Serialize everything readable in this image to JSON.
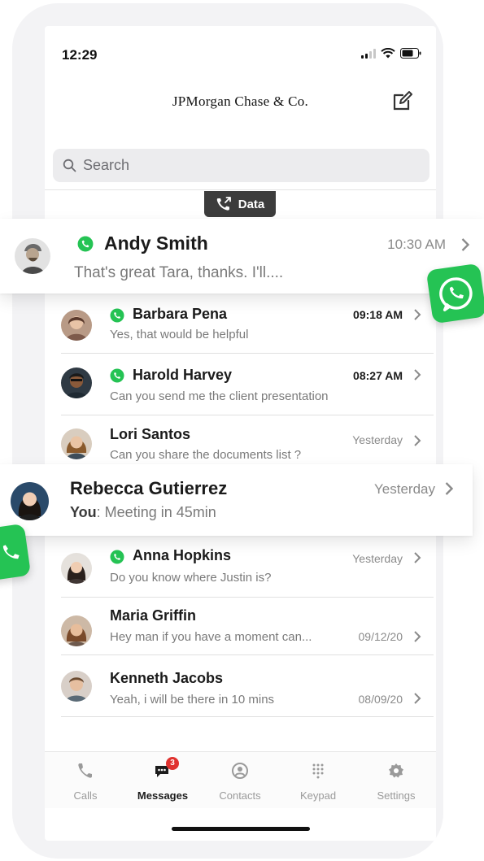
{
  "status_bar": {
    "time": "12:29"
  },
  "header": {
    "brand": "JPMorgan Chase & Co."
  },
  "search": {
    "placeholder": "Search"
  },
  "data_pill": {
    "label": "Data"
  },
  "floating_cards": [
    {
      "name": "Andy Smith",
      "message": "That's great Tara, thanks. I'll....",
      "time": "10:30 AM",
      "whatsapp": true
    },
    {
      "name": "Rebecca Gutierrez",
      "sender": "You",
      "message": ":  Meeting in 45min",
      "time": "Yesterday",
      "whatsapp": false
    }
  ],
  "conversations": [
    {
      "name": "Barbara Pena",
      "message": "Yes, that would be helpful",
      "time": "09:18 AM",
      "whatsapp": true
    },
    {
      "name": "Harold Harvey",
      "message": "Can you send me the client presentation",
      "time": "08:27 AM",
      "whatsapp": true
    },
    {
      "name": "Lori Santos",
      "message": "Can you share the documents list ?",
      "time": "Yesterday",
      "whatsapp": false
    },
    {
      "name": "Anna Hopkins",
      "message": "Do you know where Justin is?",
      "time": "Yesterday",
      "whatsapp": true
    },
    {
      "name": "Maria Griffin",
      "message": "Hey man if you have a moment can...",
      "time": "09/12/20",
      "whatsapp": false
    },
    {
      "name": "Kenneth Jacobs",
      "message": "Yeah, i will be there in 10 mins",
      "time": "08/09/20",
      "whatsapp": false
    }
  ],
  "tabbar": {
    "tabs": [
      {
        "label": "Calls",
        "icon": "phone-icon"
      },
      {
        "label": "Messages",
        "icon": "chat-icon",
        "badge": "3",
        "active": true
      },
      {
        "label": "Contacts",
        "icon": "person-icon"
      },
      {
        "label": "Keypad",
        "icon": "keypad-icon"
      },
      {
        "label": "Settings",
        "icon": "gear-icon"
      }
    ]
  },
  "colors": {
    "whatsapp_green": "#25c354",
    "badge_red": "#e0322f",
    "pill_dark": "#3c3c3c"
  }
}
